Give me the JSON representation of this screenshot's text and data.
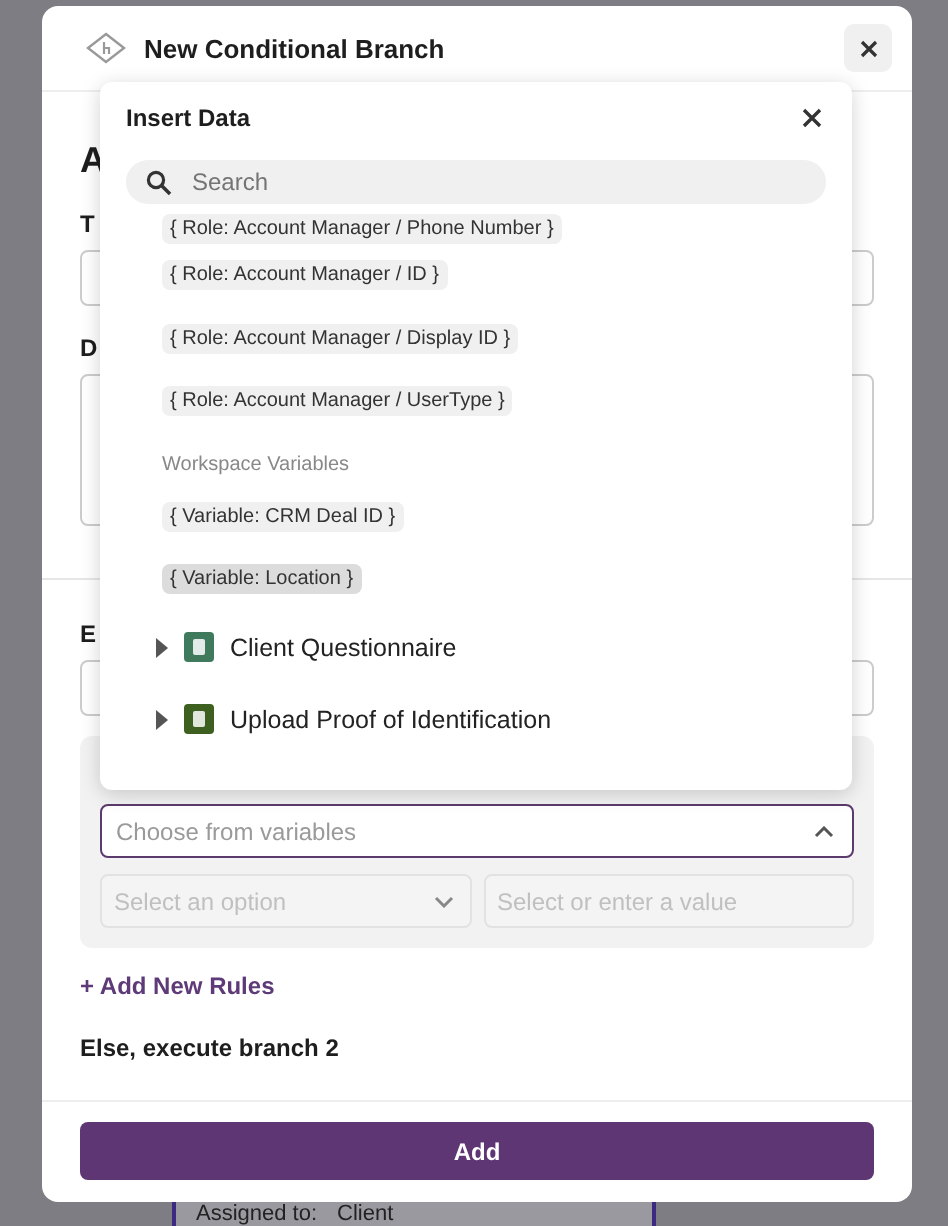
{
  "dialog": {
    "title": "New Conditional Branch"
  },
  "form": {
    "heading": "A",
    "title_label": "T",
    "description_label": "D",
    "execute_label": "E"
  },
  "rule": {
    "variable_field": {
      "placeholder": "Choose from variables",
      "expanded": true
    },
    "operator_field": {
      "placeholder": "Select an option",
      "disabled": true
    },
    "value_field": {
      "placeholder": "Select or enter a value",
      "disabled": true
    }
  },
  "add_rules_link": "+ Add New Rules",
  "else_text": "Else, execute branch 2",
  "submit_button": "Add",
  "insert_data": {
    "title": "Insert Data",
    "search": {
      "placeholder": "Search"
    },
    "items": [
      {
        "kind": "chip",
        "label": "{ Role: Account Manager / Phone Number }",
        "selected": false
      },
      {
        "kind": "chip",
        "label": "{ Role: Account Manager / ID }",
        "selected": false
      },
      {
        "kind": "chip",
        "label": "{ Role: Account Manager / Display ID }",
        "selected": false
      },
      {
        "kind": "chip",
        "label": "{ Role: Account Manager / UserType }",
        "selected": false
      },
      {
        "kind": "heading",
        "label": "Workspace Variables"
      },
      {
        "kind": "chip",
        "label": "{ Variable: CRM Deal ID }",
        "selected": false
      },
      {
        "kind": "chip",
        "label": "{ Variable: Location }",
        "selected": true
      },
      {
        "kind": "tree",
        "label": "Client Questionnaire",
        "expanded": false,
        "color": "#3f7a5c"
      },
      {
        "kind": "tree",
        "label": "Upload Proof of Identification",
        "expanded": false,
        "color": "#3d5f1f"
      }
    ]
  },
  "background": {
    "assigned_label": "Assigned to:",
    "assigned_value": "Client"
  }
}
